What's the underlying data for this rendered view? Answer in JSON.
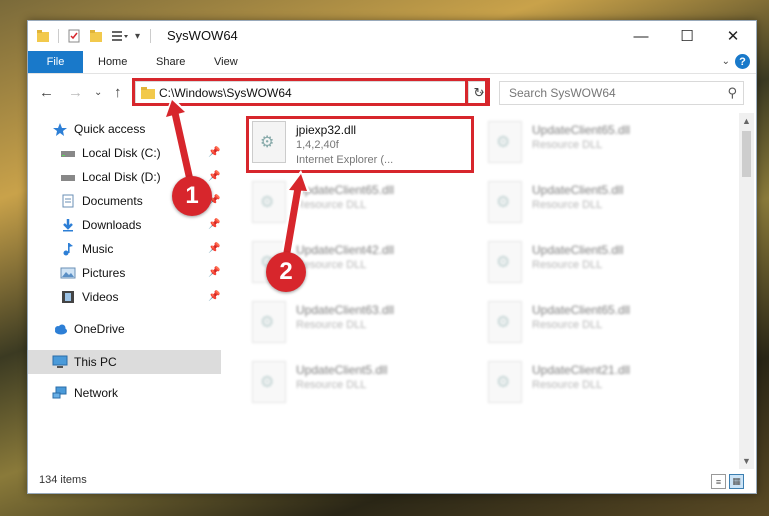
{
  "window": {
    "title": "SysWOW64",
    "minimize_icon": "—",
    "maximize_icon": "☐",
    "close_icon": "✕"
  },
  "ribbon": {
    "file": "File",
    "tabs": [
      "Home",
      "Share",
      "View"
    ],
    "expand_icon": "⌄",
    "help": "?"
  },
  "nav": {
    "back": "←",
    "forward": "→",
    "recent": "⌄",
    "up": "↑"
  },
  "address": {
    "path": "C:\\Windows\\SysWOW64",
    "dropdown": "⌄",
    "refresh": "↻"
  },
  "search": {
    "placeholder": "Search SysWOW64",
    "icon": "⚲"
  },
  "sidebar": {
    "quick_access": "Quick access",
    "items": [
      {
        "label": "Local Disk (C:)"
      },
      {
        "label": "Local Disk (D:)"
      },
      {
        "label": "Documents"
      },
      {
        "label": "Downloads"
      },
      {
        "label": "Music"
      },
      {
        "label": "Pictures"
      },
      {
        "label": "Videos"
      }
    ],
    "pin": "📌",
    "onedrive": "OneDrive",
    "this_pc": "This PC",
    "network": "Network"
  },
  "files": {
    "highlighted": {
      "name": "jpiexp32.dll",
      "version": "1,4,2,40f",
      "description": "Internet Explorer (..."
    },
    "col1": [
      {
        "name": "UpdateClient65.dll",
        "type": "Resource DLL"
      },
      {
        "name": "UpdateClient42.dll",
        "type": "Resource DLL"
      },
      {
        "name": "UpdateClient63.dll",
        "type": "Resource DLL"
      },
      {
        "name": "UpdateClient5.dll",
        "type": "Resource DLL"
      }
    ],
    "col2": [
      {
        "name": "UpdateClient65.dll",
        "type": "Resource DLL"
      },
      {
        "name": "UpdateClient5.dll",
        "type": "Resource DLL"
      },
      {
        "name": "UpdateClient5.dll",
        "type": "Resource DLL"
      },
      {
        "name": "UpdateClient65.dll",
        "type": "Resource DLL"
      },
      {
        "name": "UpdateClient21.dll",
        "type": "Resource DLL"
      }
    ]
  },
  "status": {
    "count": "134 items"
  },
  "annotations": {
    "step1": "1",
    "step2": "2"
  }
}
